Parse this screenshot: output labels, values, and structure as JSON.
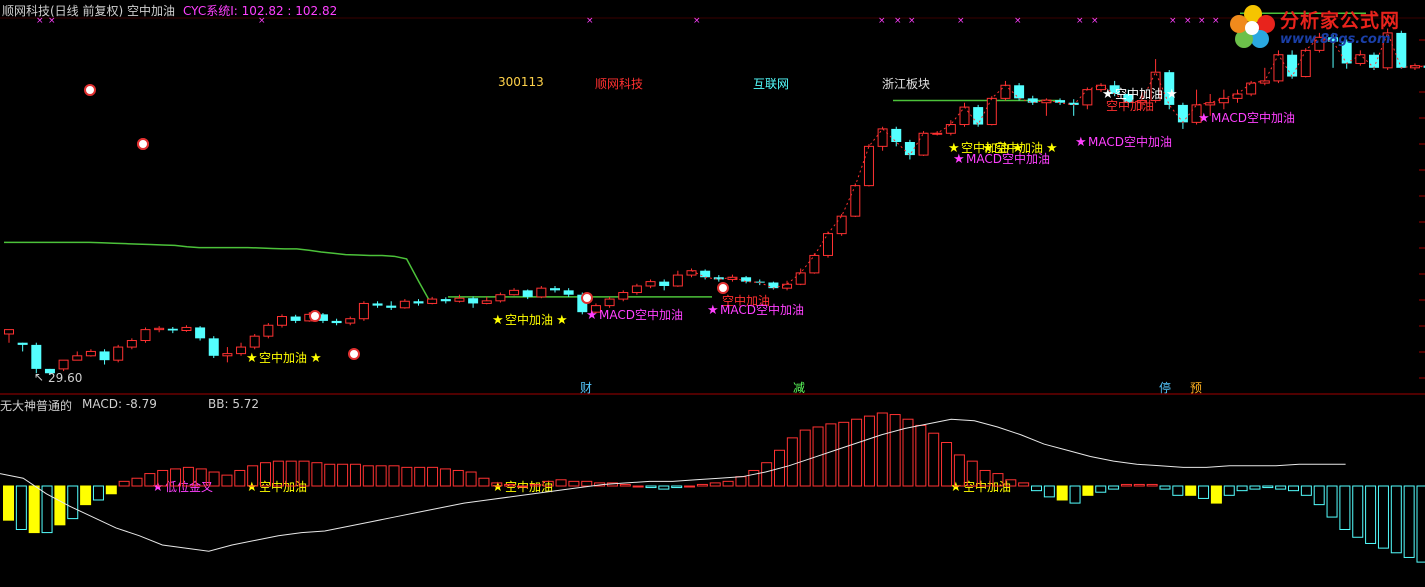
{
  "header": {
    "stock_title": "顺网科技(日线 前复权) 空中加油",
    "cyc_label": "CYC系统I: 102.82 : 102.82",
    "code": "300113",
    "name": "顺网科技",
    "industry": "互联网",
    "region": "浙江板块"
  },
  "logo": {
    "title": "分析家公式网",
    "url": "www.88gs.com"
  },
  "lower_header": {
    "indicator": "无大神普通的",
    "macd": "MACD: -8.79",
    "bb": "BB: 5.72"
  },
  "low_label": "29.60",
  "event_markers": [
    "财",
    "减",
    "停",
    "预"
  ],
  "colors": {
    "up": "#ff3232",
    "down": "#54ffff",
    "ma_line": "#4cc23a",
    "star_yellow": "#ffff00",
    "star_white": "#ffffff",
    "magenta": "#ff40ff",
    "separator": "#a00000",
    "neg_yellow": "#ffff00"
  },
  "chart_data": [
    {
      "type": "candlestick",
      "title": "顺网科技(日线 前复权) 空中加油",
      "candles": [
        [
          39,
          40,
          40,
          37
        ],
        [
          37,
          36.5,
          37,
          35
        ],
        [
          36.5,
          31,
          37,
          30
        ],
        [
          31,
          30,
          31,
          29.6
        ],
        [
          31,
          33,
          33,
          30.5
        ],
        [
          33,
          34,
          35,
          33
        ],
        [
          34,
          35,
          35.5,
          33.8
        ],
        [
          35,
          33,
          35.5,
          32
        ],
        [
          33,
          36,
          36.5,
          32.5
        ],
        [
          36,
          37.5,
          38,
          35.5
        ],
        [
          37.5,
          40,
          40.5,
          37
        ],
        [
          40,
          40.3,
          40.8,
          39.4
        ],
        [
          40.2,
          39.8,
          40.6,
          39.2
        ],
        [
          39.8,
          40.5,
          41,
          39.5
        ],
        [
          40.5,
          38,
          40.8,
          37.5
        ],
        [
          38,
          34,
          38.5,
          33.5
        ],
        [
          34,
          34.5,
          36,
          32.5
        ],
        [
          34.5,
          36,
          37,
          34
        ],
        [
          36,
          38.5,
          39,
          35.5
        ],
        [
          38.5,
          41,
          41.5,
          38
        ],
        [
          41,
          43,
          43.5,
          40.5
        ],
        [
          43,
          42,
          43.4,
          41.5
        ],
        [
          42,
          43.5,
          44,
          41.8
        ],
        [
          43.5,
          42,
          43.8,
          41.5
        ],
        [
          42,
          41.5,
          42.5,
          41
        ],
        [
          41.5,
          42.5,
          43,
          41
        ],
        [
          42.5,
          46,
          46.5,
          42
        ],
        [
          46,
          45.5,
          46.5,
          45
        ],
        [
          45.5,
          45,
          46.5,
          44.5
        ],
        [
          45,
          46.5,
          47,
          44.8
        ],
        [
          46.5,
          46,
          47,
          45.5
        ],
        [
          46,
          47,
          47.5,
          45.8
        ],
        [
          47,
          46.5,
          47.4,
          46
        ],
        [
          46.5,
          47.2,
          48,
          46.2
        ],
        [
          47.2,
          46,
          47.6,
          45
        ],
        [
          46,
          46.6,
          47.5,
          45.8
        ],
        [
          46.6,
          48,
          48.5,
          46.2
        ],
        [
          48,
          49,
          49.5,
          47.8
        ],
        [
          49,
          47.5,
          49.2,
          47
        ],
        [
          47.5,
          49.5,
          50,
          47.2
        ],
        [
          49.5,
          49,
          50,
          48.5
        ],
        [
          49,
          48,
          49.5,
          47.5
        ],
        [
          48,
          44,
          48.5,
          43.5
        ],
        [
          44,
          45.5,
          46,
          43.8
        ],
        [
          45.5,
          47,
          47.5,
          45
        ],
        [
          47,
          48.5,
          49,
          46.5
        ],
        [
          48.5,
          50,
          50.5,
          48
        ],
        [
          50,
          51,
          51.5,
          49.5
        ],
        [
          51,
          50,
          51.5,
          49
        ],
        [
          50,
          52.5,
          53.5,
          49.8
        ],
        [
          52.5,
          53.5,
          54,
          52
        ],
        [
          53.5,
          52,
          53.8,
          51.5
        ],
        [
          52,
          51.5,
          52.5,
          51
        ],
        [
          51.5,
          52,
          52.6,
          51
        ],
        [
          52,
          51,
          52.3,
          50.6
        ],
        [
          51,
          50.8,
          51.5,
          50.2
        ],
        [
          50.8,
          49.5,
          51,
          49.2
        ],
        [
          49.5,
          50.4,
          51.2,
          49
        ],
        [
          50.4,
          53,
          54,
          50.2
        ],
        [
          53,
          57,
          57.5,
          52.8
        ],
        [
          57,
          62,
          62.5,
          56.5
        ],
        [
          62,
          66,
          66.5,
          61.5
        ],
        [
          66,
          73,
          73.5,
          65.8
        ],
        [
          73,
          82,
          82.5,
          72.8
        ],
        [
          82,
          86,
          86.5,
          81
        ],
        [
          86,
          83,
          86.5,
          82
        ],
        [
          83,
          80,
          83.5,
          79
        ],
        [
          80,
          85,
          85.5,
          79.8
        ],
        [
          85,
          85,
          85.5,
          84.5
        ],
        [
          85,
          87,
          88,
          84.5
        ],
        [
          87,
          91,
          92,
          86.5
        ],
        [
          91,
          87,
          91.5,
          86.5
        ],
        [
          87,
          93,
          93.5,
          86.8
        ],
        [
          93,
          96,
          97,
          92.5
        ],
        [
          96,
          93,
          96.5,
          92.5
        ],
        [
          93,
          92,
          93.6,
          91.5
        ],
        [
          92,
          92.6,
          93,
          89
        ],
        [
          92.6,
          92,
          93,
          91.5
        ],
        [
          92,
          91.5,
          92.8,
          89
        ],
        [
          91.5,
          95,
          95.5,
          90.5
        ],
        [
          95,
          96,
          96.5,
          94.5
        ],
        [
          96,
          94,
          97,
          93.5
        ],
        [
          94,
          92,
          95,
          91.5
        ],
        [
          92,
          92.5,
          94.5,
          90.5
        ],
        [
          92.5,
          99,
          102,
          92
        ],
        [
          99,
          91.5,
          99.5,
          90.5
        ],
        [
          91.5,
          87.5,
          92,
          86
        ],
        [
          87.5,
          91.5,
          95,
          87
        ],
        [
          91.5,
          92,
          94,
          89
        ],
        [
          92,
          93,
          95,
          90.5
        ],
        [
          93,
          94,
          95,
          92
        ],
        [
          94,
          96.5,
          97,
          93.5
        ],
        [
          96.5,
          97,
          100,
          96
        ],
        [
          97,
          103,
          104,
          96.5
        ],
        [
          103,
          98,
          104,
          97.5
        ],
        [
          98,
          104,
          104.5,
          97.8
        ],
        [
          104,
          107,
          108,
          103.5
        ],
        [
          107,
          106,
          108,
          100
        ],
        [
          106,
          101,
          106.5,
          99.8
        ],
        [
          101,
          103,
          104,
          100.5
        ],
        [
          103,
          100,
          103.5,
          99.5
        ],
        [
          100,
          108,
          109,
          99.5
        ],
        [
          108,
          100,
          108.5,
          99.8
        ],
        [
          100,
          100.5,
          101,
          99.5
        ],
        [
          100.5,
          100,
          101,
          98
        ],
        [
          100,
          104,
          107,
          99.5
        ],
        [
          104,
          108,
          109,
          103.8
        ],
        [
          108,
          112,
          113,
          107.5
        ],
        [
          112,
          110,
          114,
          109.5
        ],
        [
          110,
          111,
          112,
          109.5
        ],
        [
          111,
          111,
          111.5,
          109
        ],
        [
          111,
          108,
          111.5,
          107.5
        ],
        [
          108,
          108,
          108.5,
          106
        ],
        [
          108,
          101,
          108.5,
          100
        ],
        [
          101,
          95,
          101.5,
          94
        ],
        [
          95,
          95,
          95,
          92
        ],
        [
          95,
          93,
          96,
          88
        ],
        [
          93,
          89,
          94.5,
          88.5
        ],
        [
          89,
          84,
          91,
          82
        ],
        [
          84,
          81,
          84.5,
          79
        ],
        [
          81,
          82,
          83,
          79
        ],
        [
          82,
          86,
          86.5,
          80
        ]
      ],
      "ma_line_upper": [
        112.5,
        112.5,
        112.5,
        112.5,
        112.5,
        112.5
      ],
      "ma_line_lower": [
        60,
        60,
        60,
        60,
        60,
        60,
        60,
        60,
        59.9,
        59.8,
        59.7,
        59.6,
        59.5,
        59.4,
        59.3,
        59,
        58.8,
        58.8,
        58.8,
        58.8,
        58.8,
        58.7,
        58.6,
        58.5,
        58.5,
        58.2,
        57.8,
        57.5,
        57.2,
        57.1,
        57,
        57,
        56.8,
        56.2,
        51,
        46
      ],
      "ma_line_flat_mid": 47.5,
      "low_point_label": "29.60",
      "stock_code": "300113",
      "sector": "浙江板块",
      "annotations": [
        "空中加油",
        "空中加油",
        "空中加油",
        "空中加油",
        "空中加油",
        "空中加油",
        "空中加油",
        "MACD空中加油",
        "MACD空中加油",
        "MACD空中加油",
        "MACD空中加油",
        "MACD空中加油"
      ]
    },
    {
      "type": "bar",
      "title": "无大神普通的",
      "macd_value": "-8.79",
      "bb_value": "5.72",
      "values": [
        -2.2,
        -2.8,
        -3,
        -3,
        -2.5,
        -2.1,
        -1.2,
        -0.9,
        -0.5,
        0.3,
        0.5,
        0.8,
        1.0,
        1.1,
        1.2,
        1.1,
        0.9,
        0.7,
        1.0,
        1.3,
        1.5,
        1.6,
        1.6,
        1.6,
        1.5,
        1.4,
        1.4,
        1.4,
        1.3,
        1.3,
        1.3,
        1.2,
        1.2,
        1.2,
        1.1,
        1.0,
        0.9,
        0.5,
        0.2,
        0.1,
        0.0,
        0.1,
        0.3,
        0.4,
        0.3,
        0.3,
        0.2,
        0.2,
        0.1,
        0.0,
        -0.1,
        -0.2,
        -0.1,
        0.0,
        0.1,
        0.2,
        0.3,
        0.6,
        1.0,
        1.5,
        2.3,
        3.1,
        3.6,
        3.8,
        4.0,
        4.1,
        4.3,
        4.5,
        4.7,
        4.6,
        4.3,
        3.9,
        3.4,
        2.8,
        2.0,
        1.6,
        1.0,
        0.8,
        0.4,
        0.2,
        -0.3,
        -0.7,
        -0.9,
        -1.1,
        -0.6,
        -0.4,
        -0.2,
        0.1,
        0.1,
        0.1,
        -0.2,
        -0.6,
        -0.6,
        -0.8,
        -1.1,
        -0.6,
        -0.3,
        -0.2,
        -0.1,
        -0.2,
        -0.3,
        -0.6,
        -1.2,
        -2.0,
        -2.8,
        -3.3,
        -3.7,
        -4.0,
        -4.3,
        -4.6,
        -4.9,
        -5.2
      ],
      "white_line": [
        0.8,
        0.5,
        -0.5,
        -1.3,
        -2.0,
        -2.7,
        -3.2,
        -3.8,
        -4.0,
        -4.2,
        -3.8,
        -3.5,
        -3.2,
        -3.0,
        -2.9,
        -2.6,
        -2.3,
        -2.0,
        -1.7,
        -1.4,
        -1.1,
        -0.9,
        -0.7,
        -0.5,
        -0.3,
        -0.1,
        0.1,
        0.2,
        0.3,
        0.3,
        0.4,
        0.5,
        0.6,
        0.9,
        1.3,
        1.8,
        2.3,
        2.8,
        3.3,
        3.7,
        4.0,
        4.3,
        4.2,
        3.8,
        3.3,
        2.7,
        2.3,
        1.9,
        1.6,
        1.4,
        1.3,
        1.2,
        1.2,
        1.3,
        1.3,
        1.3,
        1.4,
        1.4,
        1.4
      ],
      "ylim": [
        -6,
        5
      ]
    }
  ]
}
